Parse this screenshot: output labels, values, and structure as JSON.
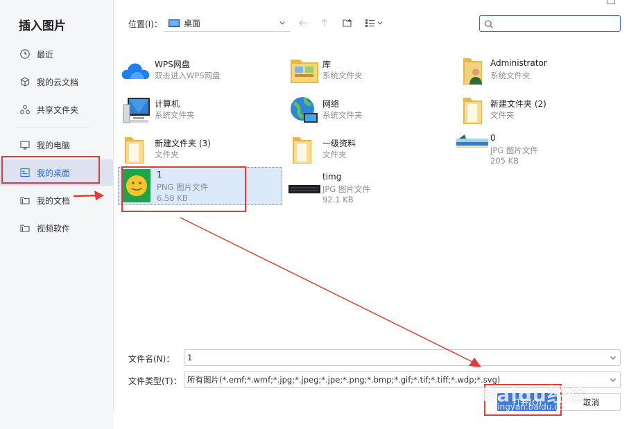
{
  "sidebar": {
    "title": "插入图片",
    "items": [
      {
        "label": "最近",
        "icon": "clock-icon"
      },
      {
        "label": "我的云文档",
        "icon": "cube-icon"
      },
      {
        "label": "共享文件夹",
        "icon": "share-nodes-icon"
      },
      {
        "label": "我的电脑",
        "icon": "monitor-icon"
      },
      {
        "label": "我的桌面",
        "icon": "desktop-icon",
        "active": true
      },
      {
        "label": "我的文档",
        "icon": "folder-icon"
      },
      {
        "label": "视频软件",
        "icon": "folder-icon"
      }
    ]
  },
  "toolbar": {
    "location_label": "位置(I)：",
    "location_value": "桌面",
    "search_placeholder": ""
  },
  "files": [
    {
      "name": "WPS网盘",
      "sub1": "双击进入WPS网盘",
      "sub2": "",
      "icon": "cloud-icon"
    },
    {
      "name": "库",
      "sub1": "系统文件夹",
      "sub2": "",
      "icon": "library-folder-icon"
    },
    {
      "name": "Administrator",
      "sub1": "系统文件夹",
      "sub2": "",
      "icon": "user-folder-icon"
    },
    {
      "name": "计算机",
      "sub1": "系统文件夹",
      "sub2": "",
      "icon": "computer-icon"
    },
    {
      "name": "网络",
      "sub1": "系统文件夹",
      "sub2": "",
      "icon": "network-globe-icon"
    },
    {
      "name": "新建文件夹 (2)",
      "sub1": "文件夹",
      "sub2": "",
      "icon": "folder-icon"
    },
    {
      "name": "新建文件夹 (3)",
      "sub1": "文件夹",
      "sub2": "",
      "icon": "folder-icon"
    },
    {
      "name": "一级资料",
      "sub1": "文件夹",
      "sub2": "",
      "icon": "folder-icon"
    },
    {
      "name": "0",
      "sub1": "JPG 图片文件",
      "sub2": "205 KB",
      "icon": "beach-image-thumb"
    },
    {
      "name": "1",
      "sub1": "PNG 图片文件",
      "sub2": "6.58 KB",
      "icon": "smiley-image-thumb",
      "selected": true
    },
    {
      "name": "timg",
      "sub1": "JPG 图片文件",
      "sub2": "92.1 KB",
      "icon": "keyboard-image-thumb"
    }
  ],
  "bottom": {
    "filename_label": "文件名(N)：",
    "filename_value": "1",
    "filetype_label": "文件类型(T)：",
    "filetype_value": "所有图片(*.emf;*.wmf;*.jpg;*.jpeg;*.jpe;*.png;*.bmp;*.gif;*.tif;*.tiff;*.wdp;*.svg)",
    "open_label": "打开(O)",
    "cancel_label": "取消"
  },
  "watermark": {
    "line1": "Baidu经验",
    "line2": "jingyan.baidu.com"
  },
  "colors": {
    "accent": "#2b6fd6",
    "open_button": "#3d7be0",
    "annotation_red": "#e53935",
    "selected_bg": "#dbe9fb"
  }
}
